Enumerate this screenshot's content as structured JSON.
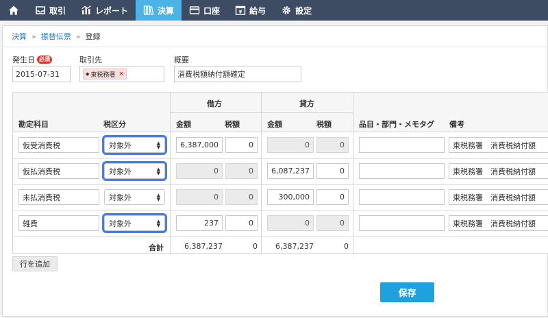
{
  "nav": {
    "home_icon": "home-icon",
    "items": [
      {
        "label": "取引",
        "icon": "inbox-icon"
      },
      {
        "label": "レポート",
        "icon": "bar-chart-icon"
      },
      {
        "label": "決算",
        "icon": "books-icon"
      },
      {
        "label": "口座",
        "icon": "credit-card-icon"
      },
      {
        "label": "給与",
        "icon": "payroll-icon"
      },
      {
        "label": "設定",
        "icon": "gear-icon"
      }
    ],
    "active_color": "#4bb3e6"
  },
  "breadcrumb": [
    "決算",
    "振替伝票",
    "登録"
  ],
  "form": {
    "date_label": "発生日",
    "required_badge": "必須",
    "date_value": "2015-07-31",
    "partner_label": "取引先",
    "partner_tag": "東税務署",
    "summary_label": "概要",
    "summary_value": "消費税額納付額確定"
  },
  "table": {
    "headers": {
      "account": "勘定科目",
      "tax_category": "税区分",
      "debit": "借方",
      "credit": "貸方",
      "amount": "金額",
      "tax": "税額",
      "item": "品目・部門・メモタグ",
      "remarks": "備考"
    },
    "rows": [
      {
        "account": "仮受消費税",
        "tax_category": "対象外",
        "highlight": true,
        "debit_amount": "6,387,000",
        "debit_tax": "0",
        "credit_amount": "0",
        "credit_tax": "0",
        "item": "",
        "remarks": "東税務署　消費税納付額"
      },
      {
        "account": "仮払消費税",
        "tax_category": "対象外",
        "highlight": true,
        "debit_amount": "0",
        "debit_tax": "0",
        "credit_amount": "6,087,237",
        "credit_tax": "0",
        "item": "",
        "remarks": "東税務署　消費税納付額"
      },
      {
        "account": "未払消費税",
        "tax_category": "対象外",
        "highlight": false,
        "debit_amount": "0",
        "debit_tax": "0",
        "credit_amount": "300,000",
        "credit_tax": "0",
        "item": "",
        "remarks": "東税務署　消費税納付額"
      },
      {
        "account": "雑費",
        "tax_category": "対象外",
        "highlight": true,
        "debit_amount": "237",
        "debit_tax": "0",
        "credit_amount": "0",
        "credit_tax": "0",
        "item": "",
        "remarks": "東税務署　消費税納付額"
      }
    ],
    "totals": {
      "label": "合計",
      "debit_amount": "6,387,237",
      "debit_tax": "0",
      "credit_amount": "6,387,237",
      "credit_tax": "0"
    }
  },
  "buttons": {
    "add_row": "行を追加",
    "save": "保存"
  },
  "colors": {
    "nav_bg": "#3d4c63",
    "save": "#1fa1de",
    "highlight_outline": "#3b7ff0",
    "required": "#e4352f"
  }
}
